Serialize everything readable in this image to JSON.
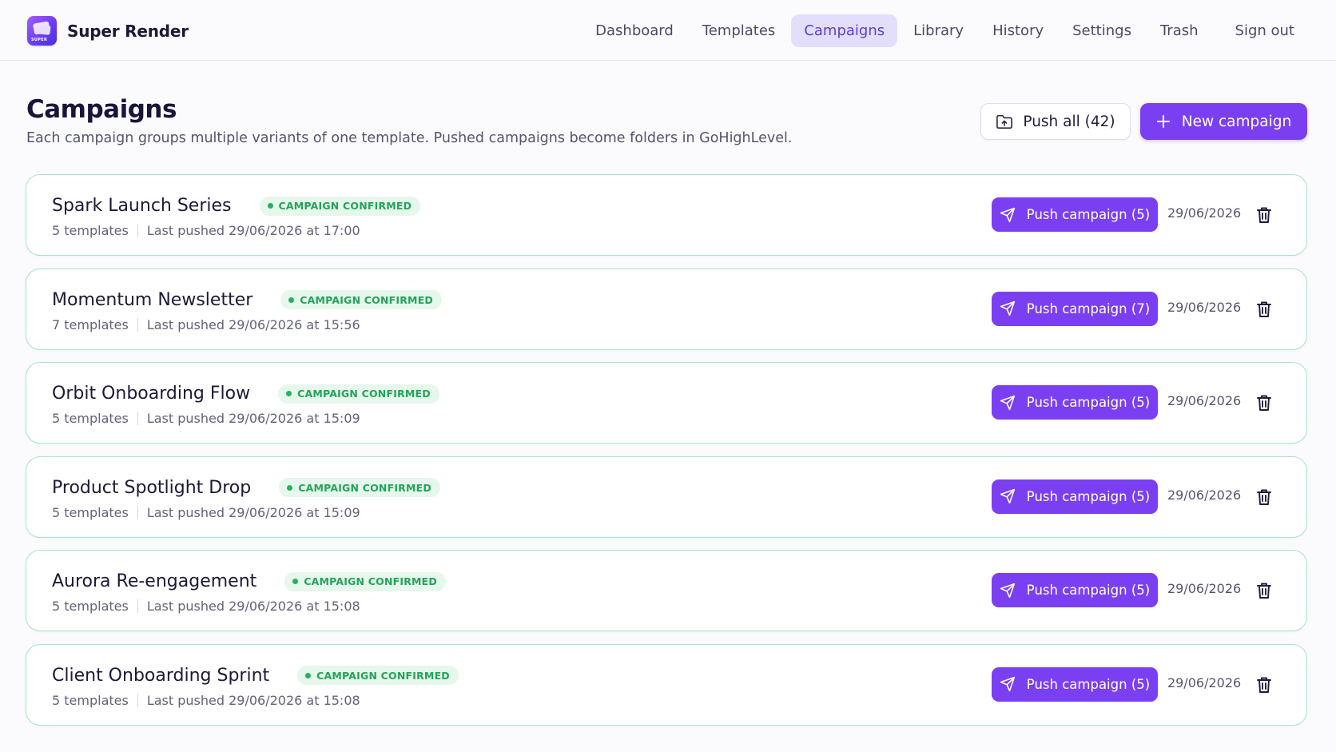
{
  "brand": {
    "name": "Super Render",
    "logo_tag": "SUPER"
  },
  "nav": {
    "items": [
      {
        "label": "Dashboard",
        "active": false
      },
      {
        "label": "Templates",
        "active": false
      },
      {
        "label": "Campaigns",
        "active": true
      },
      {
        "label": "Library",
        "active": false
      },
      {
        "label": "History",
        "active": false
      },
      {
        "label": "Settings",
        "active": false
      },
      {
        "label": "Trash",
        "active": false
      }
    ],
    "sign_out": "Sign out"
  },
  "page": {
    "title": "Campaigns",
    "subtitle": "Each campaign groups multiple variants of one template. Pushed campaigns become folders in GoHighLevel.",
    "push_all_label": "Push all (42)",
    "new_campaign_label": "New campaign"
  },
  "colors": {
    "accent": "#7b3ff2",
    "confirmed": "#23a45a",
    "card_border": "#a8e6c3"
  },
  "campaigns": [
    {
      "name": "Spark Launch Series",
      "status": "CAMPAIGN CONFIRMED",
      "templates": "5 templates",
      "last_pushed": "Last pushed 29/06/2026 at 17:00",
      "push_label": "Push campaign (5)",
      "date": "29/06/2026"
    },
    {
      "name": "Momentum Newsletter",
      "status": "CAMPAIGN CONFIRMED",
      "templates": "7 templates",
      "last_pushed": "Last pushed 29/06/2026 at 15:56",
      "push_label": "Push campaign (7)",
      "date": "29/06/2026"
    },
    {
      "name": "Orbit Onboarding Flow",
      "status": "CAMPAIGN CONFIRMED",
      "templates": "5 templates",
      "last_pushed": "Last pushed 29/06/2026 at 15:09",
      "push_label": "Push campaign (5)",
      "date": "29/06/2026"
    },
    {
      "name": "Product Spotlight Drop",
      "status": "CAMPAIGN CONFIRMED",
      "templates": "5 templates",
      "last_pushed": "Last pushed 29/06/2026 at 15:09",
      "push_label": "Push campaign (5)",
      "date": "29/06/2026"
    },
    {
      "name": "Aurora Re-engagement",
      "status": "CAMPAIGN CONFIRMED",
      "templates": "5 templates",
      "last_pushed": "Last pushed 29/06/2026 at 15:08",
      "push_label": "Push campaign (5)",
      "date": "29/06/2026"
    },
    {
      "name": "Client Onboarding Sprint",
      "status": "CAMPAIGN CONFIRMED",
      "templates": "5 templates",
      "last_pushed": "Last pushed 29/06/2026 at 15:08",
      "push_label": "Push campaign (5)",
      "date": "29/06/2026"
    }
  ]
}
